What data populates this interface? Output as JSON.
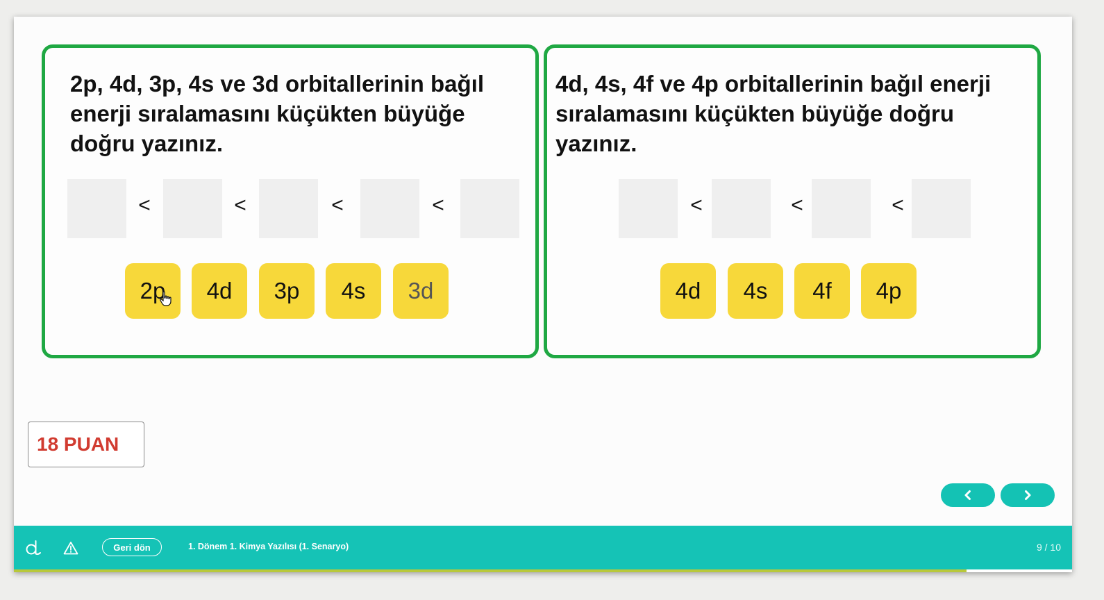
{
  "cards": [
    {
      "question": "2p, 4d, 3p, 4s ve 3d orbitallerinin bağıl enerji sıralamasını küçükten büyüğe doğru yazınız.",
      "separator": "<",
      "chips": [
        "2p",
        "4d",
        "3p",
        "4s",
        "3d"
      ]
    },
    {
      "question": "4d, 4s, 4f ve 4p orbitallerinin bağıl enerji sıralamasını küçükten büyüğe doğru yazınız.",
      "separator": "<",
      "chips": [
        "4d",
        "4s",
        "4f",
        "4p"
      ]
    }
  ],
  "score": "18 PUAN",
  "nav": {
    "prev_icon": "chevron-left-icon",
    "next_icon": "chevron-right-icon"
  },
  "bottom_bar": {
    "logo_icon": "logo-icon",
    "warning_icon": "warning-icon",
    "back_label": "Geri dön",
    "course_title": "1. Dönem 1. Kimya Yazılısı (1. Senaryo)",
    "page_indicator": "9 / 10",
    "progress": 0.9
  },
  "colors": {
    "card_border": "#1fa843",
    "chip": "#f7d83a",
    "accent": "#15c3b6",
    "score_text": "#d13b30"
  }
}
